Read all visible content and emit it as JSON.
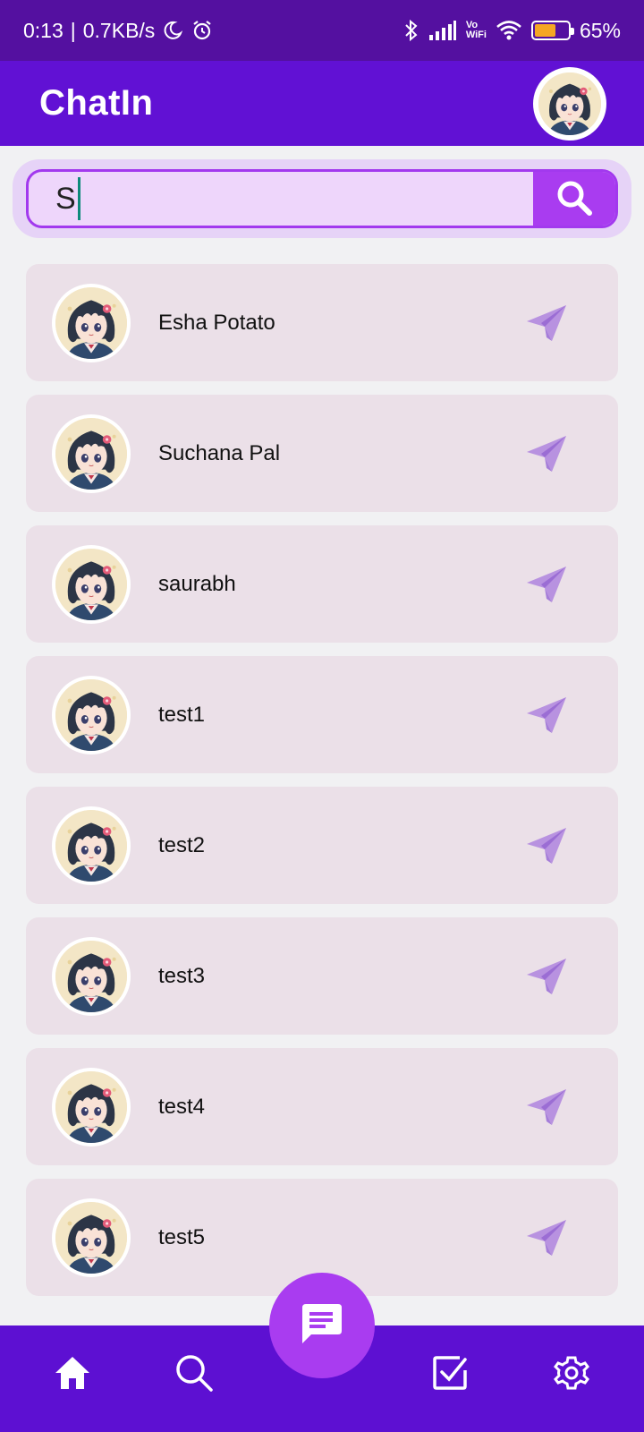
{
  "status_bar": {
    "time": "0:13",
    "speed": "0.7KB/s",
    "vo_label": "Vo",
    "wifi_label": "WiFi",
    "battery_percent": "65%",
    "battery_level": 0.65,
    "icons": [
      "moon-icon",
      "alarm-icon",
      "bluetooth-icon",
      "signal-icon",
      "wifi-icon",
      "battery-icon"
    ]
  },
  "app_bar": {
    "title": "ChatIn"
  },
  "search": {
    "value": "S",
    "icon": "search-icon"
  },
  "contacts": [
    {
      "name": "Esha Potato"
    },
    {
      "name": "Suchana Pal"
    },
    {
      "name": "saurabh"
    },
    {
      "name": "test1"
    },
    {
      "name": "test2"
    },
    {
      "name": "test3"
    },
    {
      "name": "test4"
    },
    {
      "name": "test5"
    }
  ],
  "bottom_nav": {
    "items": [
      "home-icon",
      "search-icon",
      "chat-icon",
      "tasks-icon",
      "settings-icon"
    ]
  },
  "colors": {
    "status_bar": "#5410a0",
    "app_bar": "#6111d4",
    "accent": "#a93cf0",
    "card": "#ebe0e8",
    "send_icon": "#b892e0"
  }
}
